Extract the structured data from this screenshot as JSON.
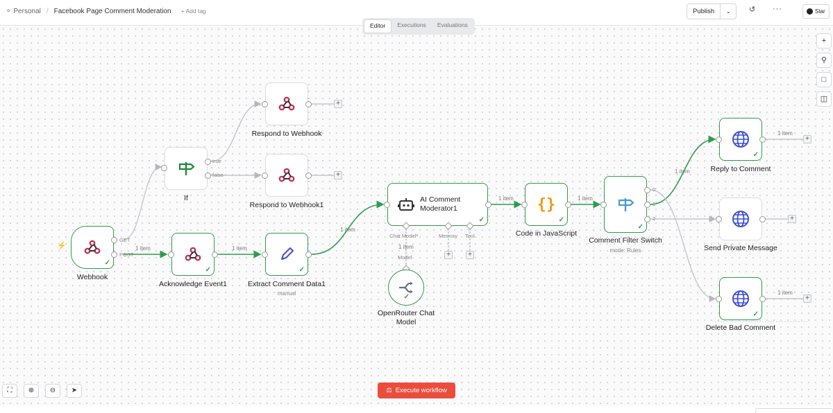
{
  "header": {
    "workspace": "Personal",
    "workflow_name": "Facebook Page Comment Moderation",
    "add_tag": "+ Add tag",
    "publish_label": "Publish",
    "star_label": "Star"
  },
  "tabs": [
    {
      "label": "Editor",
      "active": true
    },
    {
      "label": "Executions",
      "active": false
    },
    {
      "label": "Evaluations",
      "active": false
    }
  ],
  "nodes": {
    "webhook": {
      "label": "Webhook",
      "out_get": "GET",
      "out_post": "POST"
    },
    "if": {
      "label": "If",
      "out_true": "true",
      "out_false": "false"
    },
    "respond": {
      "label": "Respond to Webhook"
    },
    "respond1": {
      "label": "Respond to Webhook1"
    },
    "ack": {
      "label": "Acknowledge Event1"
    },
    "extract": {
      "label": "Extract Comment Data1",
      "subtitle": "manual"
    },
    "ai": {
      "title_line1": "AI Comment",
      "title_line2": "Moderator1",
      "sub_chat": "Chat Model",
      "sub_chat_required": "*",
      "sub_memory": "Memory",
      "sub_tool": "Tool"
    },
    "openrouter": {
      "label_line1": "OpenRouter Chat",
      "label_line2": "Model",
      "conn_label": "Model"
    },
    "code": {
      "label": "Code in JavaScript"
    },
    "switch": {
      "label": "Comment Filter Switch",
      "subtitle": "mode: Rules",
      "out0": "0",
      "out1": "1",
      "out2": "2"
    },
    "reply": {
      "label": "Reply to Comment"
    },
    "private": {
      "label": "Send Private Message"
    },
    "delete": {
      "label": "Delete Bad Comment"
    }
  },
  "edges": {
    "webhook_ack": "1 item",
    "ack_extract": "1 item",
    "extract_ai": "1 item",
    "model_ai": "1 item",
    "ai_code": "1 item",
    "code_switch": "1 item",
    "switch_reply": "1 item",
    "reply_out": "1 item",
    "delete_out": "1 item"
  },
  "footer": {
    "execute_label": "Execute workflow"
  },
  "colors": {
    "success": "#2e9d4b",
    "webhook_pink": "#c4335a",
    "execute_red": "#eb4d3d",
    "globe_blue": "#3c4fd6",
    "code_orange": "#f19a0e",
    "switch_blue": "#4a9ad6"
  }
}
